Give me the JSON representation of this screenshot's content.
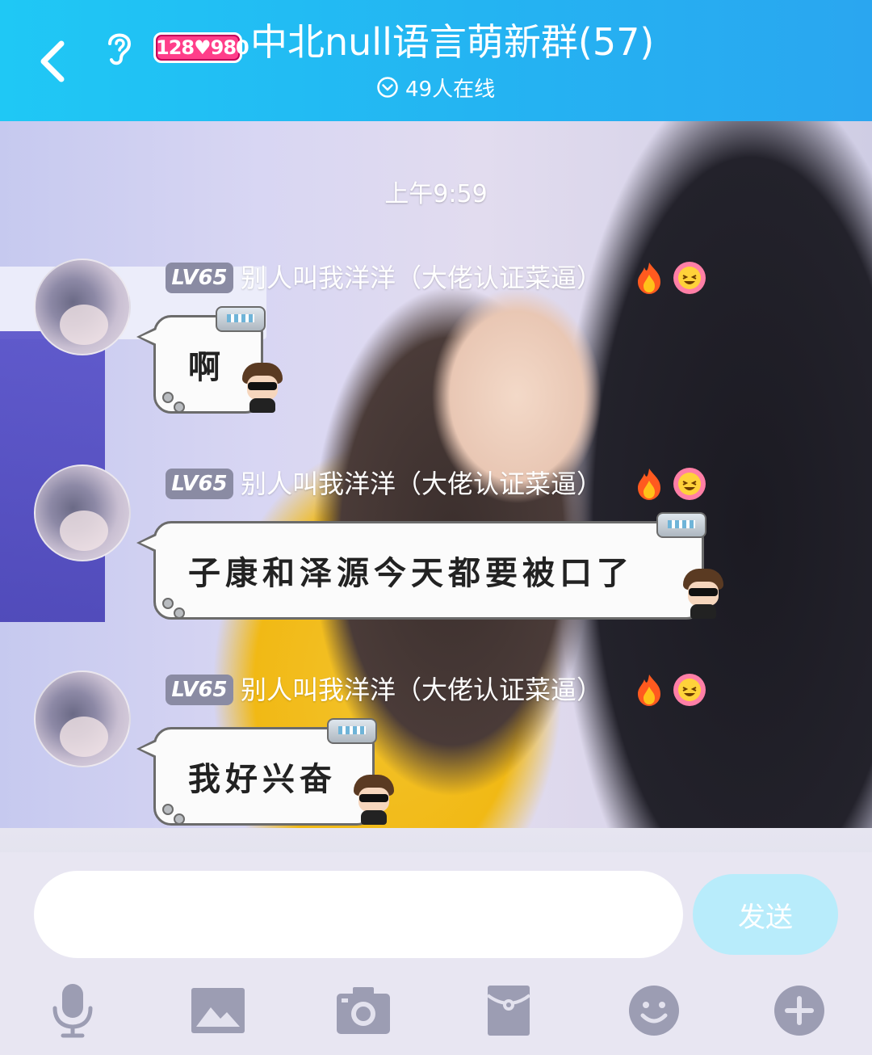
{
  "header": {
    "badge": "128♥980",
    "title": "中北null语言萌新群(57)",
    "online": "49人在线"
  },
  "chat": {
    "time": "上午9:59",
    "messages": [
      {
        "level": "LV65",
        "nickname": "别人叫我洋洋（大佬认证菜逼）",
        "text": "啊"
      },
      {
        "level": "LV65",
        "nickname": "别人叫我洋洋（大佬认证菜逼）",
        "text": "子康和泽源今天都要被口了"
      },
      {
        "level": "LV65",
        "nickname": "别人叫我洋洋（大佬认证菜逼）",
        "text": "我好兴奋"
      }
    ]
  },
  "input": {
    "value": "",
    "placeholder": "",
    "send_label": "发送"
  },
  "toolbar": {
    "icons": [
      "microphone-icon",
      "image-icon",
      "camera-icon",
      "red-packet-icon",
      "emoji-icon",
      "plus-icon"
    ]
  },
  "colors": {
    "header_start": "#1fc8f5",
    "header_end": "#2aa6f0",
    "send_button": "#b8ecfb",
    "toolbar_icon": "#9c9db3",
    "level_badge": "#8a8ba3"
  }
}
